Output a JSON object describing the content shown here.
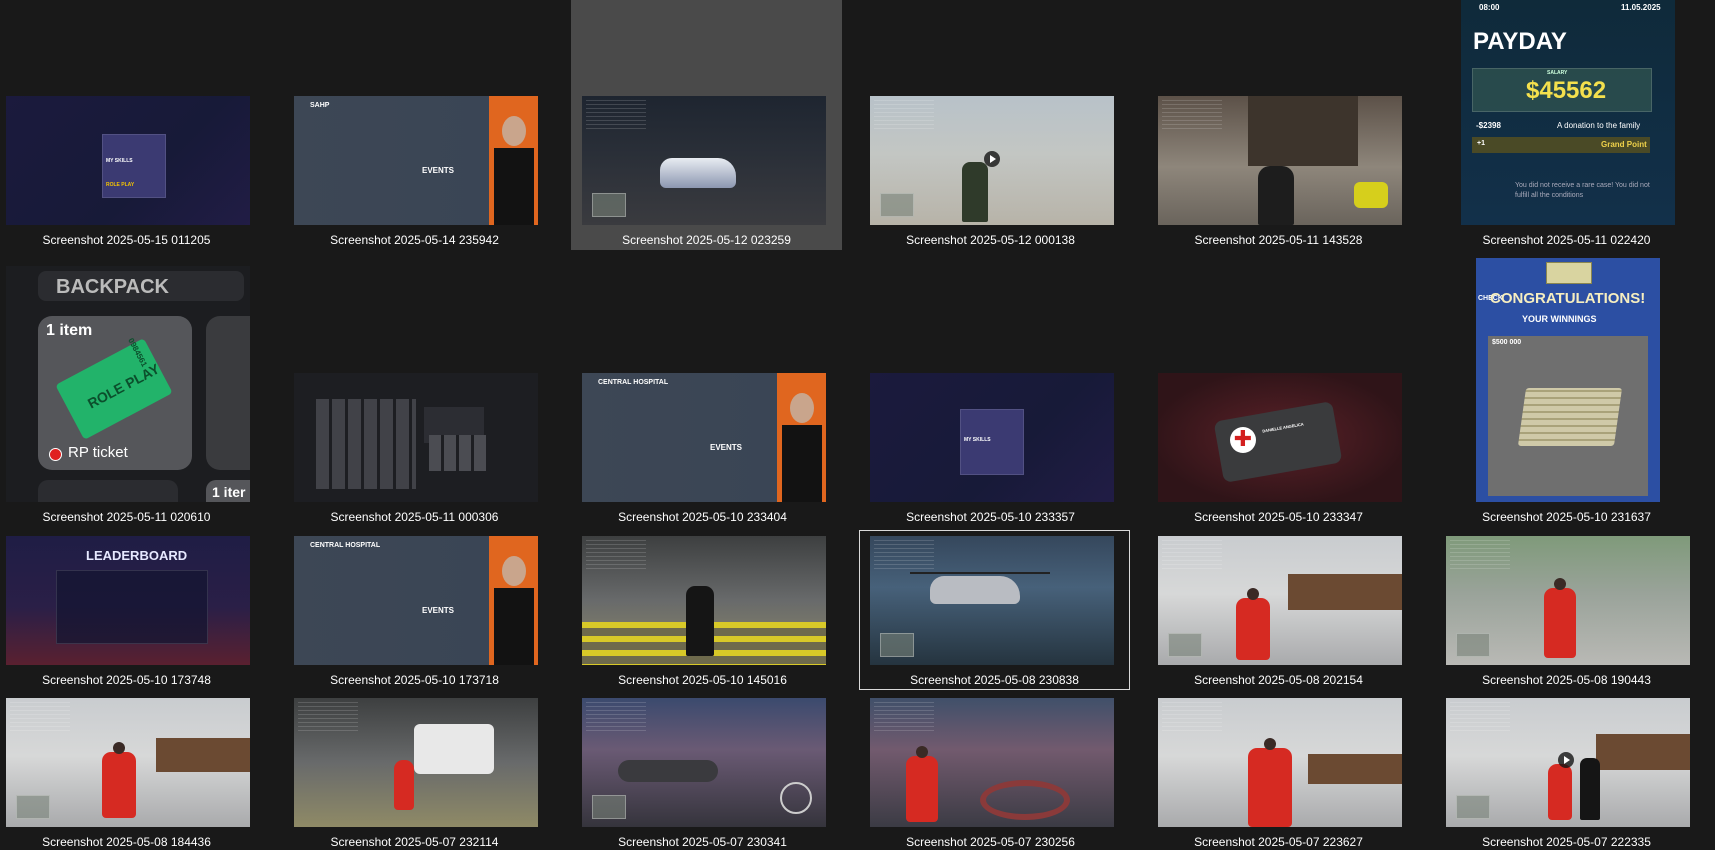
{
  "gallery": {
    "tiles": [
      {
        "caption": "Screenshot 2025-05-15 011205"
      },
      {
        "caption": "Screenshot 2025-05-14 235942",
        "overlay": "SAHP",
        "overlay2": "EVENTS"
      },
      {
        "caption": "Screenshot 2025-05-12 023259"
      },
      {
        "caption": "Screenshot 2025-05-12 000138"
      },
      {
        "caption": "Screenshot 2025-05-11 143528"
      },
      {
        "caption": "Screenshot 2025-05-11 022420",
        "time": "08:00",
        "date": "11.05.2025",
        "title": "PAYDAY",
        "salary_label": "SALARY",
        "amount": "$45562",
        "deduction": "-$2398",
        "deduction_note": "A donation to the family",
        "points": "+1",
        "points_label": "Grand Point",
        "note": "You did not receive a rare case! You did not fulfill all the conditions"
      },
      {
        "caption": "Screenshot 2025-05-11 020610",
        "title": "BACKPACK",
        "count": "1 item",
        "ticket": "ROLE PLAY",
        "ticket_code": "0984561",
        "item_name": "RP ticket",
        "partial": "1 iter"
      },
      {
        "caption": "Screenshot 2025-05-11 000306"
      },
      {
        "caption": "Screenshot 2025-05-10 233404",
        "overlay": "CENTRAL HOSPITAL",
        "overlay2": "EVENTS"
      },
      {
        "caption": "Screenshot 2025-05-10 233357",
        "overlay": "MY SKILLS"
      },
      {
        "caption": "Screenshot 2025-05-10 233347",
        "overlay": "DANIELLE ANGELICA"
      },
      {
        "caption": "Screenshot 2025-05-10 231637",
        "title": "CONGRATULATIONS!",
        "subtitle": "YOUR WINNINGS",
        "amount": "$500 000",
        "check": "CHECK"
      },
      {
        "caption": "Screenshot 2025-05-10 173748",
        "overlay": "LEADERBOARD"
      },
      {
        "caption": "Screenshot 2025-05-10 173718",
        "overlay": "CENTRAL HOSPITAL",
        "overlay2": "EVENTS"
      },
      {
        "caption": "Screenshot 2025-05-10 145016"
      },
      {
        "caption": "Screenshot 2025-05-08 230838"
      },
      {
        "caption": "Screenshot 2025-05-08 202154"
      },
      {
        "caption": "Screenshot 2025-05-08 190443"
      },
      {
        "caption": "Screenshot 2025-05-08 184436"
      },
      {
        "caption": "Screenshot 2025-05-07 232114"
      },
      {
        "caption": "Screenshot 2025-05-07 230341"
      },
      {
        "caption": "Screenshot 2025-05-07 230256"
      },
      {
        "caption": "Screenshot 2025-05-07 223627"
      },
      {
        "caption": "Screenshot 2025-05-07 222335"
      }
    ],
    "first_tile_overlay": "MY SKILLS",
    "first_tile_overlay2": "ROLE PLAY",
    "selected_index": 2,
    "focused_index": 15
  }
}
